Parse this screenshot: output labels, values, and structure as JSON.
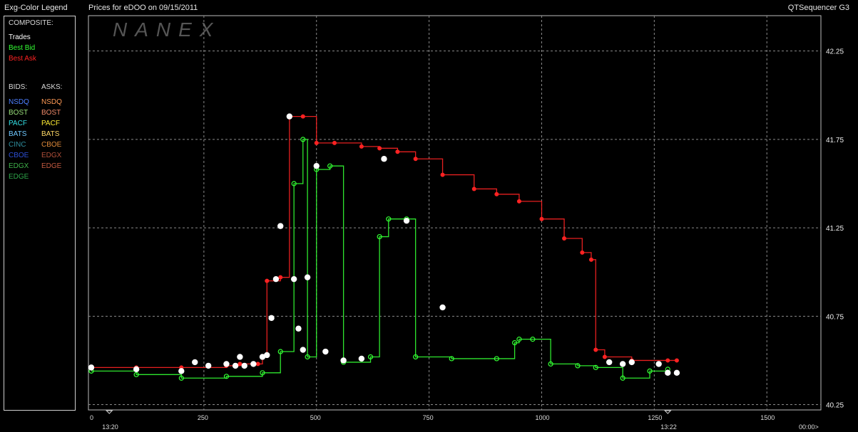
{
  "header": {
    "legend_title": "Exg-Color Legend",
    "chart_title": "Prices for  eDOO  on  09/15/2011",
    "app_name": "QTSequencer G3"
  },
  "legend": {
    "composite_label": "COMPOSITE:",
    "composite": [
      {
        "label": "Trades",
        "color": "#ffffff"
      },
      {
        "label": "Best Bid",
        "color": "#33ff33"
      },
      {
        "label": "Best Ask",
        "color": "#ff2222"
      }
    ],
    "bids_label": "BIDS:",
    "asks_label": "ASKS:",
    "bids": [
      {
        "label": "NSDQ",
        "color": "#4d7fff"
      },
      {
        "label": "BOST",
        "color": "#99e07a"
      },
      {
        "label": "PACF",
        "color": "#33e0e6"
      },
      {
        "label": "BATS",
        "color": "#6fc8ff"
      },
      {
        "label": "CINC",
        "color": "#2f8f9f"
      },
      {
        "label": "CBOE",
        "color": "#2d4fd6"
      },
      {
        "label": "EDGX",
        "color": "#3fb24a"
      },
      {
        "label": "EDGE",
        "color": "#2ea84a"
      }
    ],
    "asks": [
      {
        "label": "NSDQ",
        "color": "#ff9955"
      },
      {
        "label": "BOST",
        "color": "#f08a6a"
      },
      {
        "label": "PACF",
        "color": "#ffee33"
      },
      {
        "label": "BATS",
        "color": "#ffd966"
      },
      {
        "label": "CBOE",
        "color": "#e08a3a"
      },
      {
        "label": "EDGX",
        "color": "#b3503a"
      },
      {
        "label": "EDGE",
        "color": "#c45a40"
      }
    ]
  },
  "watermark": "NANEX",
  "chart_data": {
    "type": "line",
    "title": "Prices for  eDOO  on  09/15/2011",
    "x_ticks": [
      0,
      250,
      500,
      750,
      1000,
      1250,
      1500
    ],
    "x_range": [
      0,
      1620
    ],
    "time_labels": [
      {
        "x": 40,
        "label": "13:20"
      },
      {
        "x": 1280,
        "label": "13:22"
      }
    ],
    "end_label": "00:00>",
    "y_ticks": [
      "40.25",
      "40.75",
      "41.25",
      "41.75",
      "42.25"
    ],
    "ylim": [
      40.22,
      42.45
    ],
    "grid": true,
    "series": [
      {
        "name": "Best Ask",
        "color": "#ff2222",
        "x": [
          0,
          100,
          200,
          300,
          330,
          370,
          380,
          390,
          420,
          440,
          470,
          500,
          540,
          600,
          640,
          680,
          720,
          780,
          850,
          900,
          950,
          1000,
          1050,
          1090,
          1110,
          1120,
          1140,
          1200,
          1280,
          1300
        ],
        "y": [
          40.46,
          40.46,
          40.46,
          40.47,
          40.48,
          40.48,
          40.52,
          40.95,
          40.97,
          41.88,
          41.88,
          41.73,
          41.73,
          41.71,
          41.7,
          41.68,
          41.64,
          41.55,
          41.47,
          41.44,
          41.4,
          41.3,
          41.19,
          41.11,
          41.07,
          40.56,
          40.52,
          40.5,
          40.5,
          40.5
        ]
      },
      {
        "name": "Best Bid",
        "color": "#33ff33",
        "x": [
          0,
          100,
          200,
          300,
          380,
          420,
          450,
          470,
          480,
          500,
          530,
          560,
          620,
          640,
          660,
          700,
          720,
          800,
          900,
          940,
          950,
          980,
          1020,
          1080,
          1120,
          1180,
          1240,
          1280
        ],
        "y": [
          40.44,
          40.42,
          40.4,
          40.41,
          40.43,
          40.55,
          41.5,
          41.75,
          40.52,
          41.58,
          41.6,
          40.49,
          40.52,
          41.2,
          41.3,
          41.3,
          40.52,
          40.51,
          40.51,
          40.6,
          40.62,
          40.62,
          40.48,
          40.47,
          40.46,
          40.4,
          40.44,
          40.45
        ]
      },
      {
        "name": "Trades",
        "color": "#ffffff",
        "x": [
          0,
          100,
          200,
          230,
          260,
          300,
          320,
          330,
          340,
          360,
          380,
          390,
          400,
          410,
          420,
          440,
          450,
          460,
          470,
          480,
          500,
          520,
          560,
          600,
          650,
          700,
          780,
          1150,
          1180,
          1200,
          1260,
          1280,
          1300
        ],
        "y": [
          40.46,
          40.45,
          40.44,
          40.49,
          40.47,
          40.48,
          40.47,
          40.52,
          40.47,
          40.48,
          40.52,
          40.53,
          40.74,
          40.96,
          41.26,
          41.88,
          40.96,
          40.68,
          40.56,
          40.97,
          41.6,
          40.55,
          40.5,
          40.51,
          41.64,
          41.29,
          40.8,
          40.49,
          40.48,
          40.49,
          40.48,
          40.43,
          40.43
        ]
      }
    ]
  }
}
